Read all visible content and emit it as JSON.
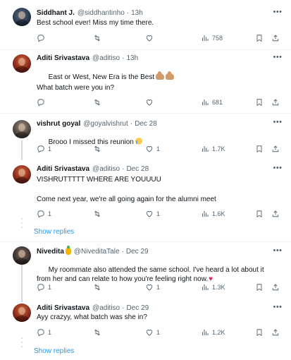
{
  "colors": {
    "text_primary": "#0f1419",
    "text_secondary": "#536471",
    "link": "#1d9bf0",
    "divider": "#eff3f4",
    "thread_line": "#cfd9de"
  },
  "icons": {
    "more": "more-dots-icon",
    "reply": "reply-icon",
    "retweet": "retweet-icon",
    "like": "heart-icon",
    "views": "views-icon",
    "bookmark": "bookmark-icon",
    "share": "share-icon"
  },
  "tweets": [
    {
      "name": "Siddhant J.",
      "handle": "@siddhantinho",
      "separator": "·",
      "time": "13h",
      "text": "Best school ever! Miss my time there.",
      "replies": "",
      "retweets": "",
      "likes": "",
      "views": "758"
    },
    {
      "name": "Aditi Srivastava",
      "handle": "@aditiso",
      "separator": "·",
      "time": "13h",
      "text": "East or West, New Era is the Best",
      "text_line2": "What batch were you in?",
      "replies": "",
      "retweets": "",
      "likes": "",
      "views": "681"
    },
    {
      "name": "vishrut goyal",
      "handle": "@goyalvishrut",
      "separator": "·",
      "time": "Dec 28",
      "text": "Brooo I missed this reunion",
      "replies": "1",
      "retweets": "",
      "likes": "1",
      "views": "1.7K"
    },
    {
      "name": "Aditi Srivastava",
      "handle": "@aditiso",
      "separator": "·",
      "time": "Dec 28",
      "text": "VISHRUTTTTT WHERE ARE YOUUUU",
      "text_line2": "Come next year, we're all going again for the alumni meet",
      "replies": "1",
      "retweets": "",
      "likes": "1",
      "views": "1.6K"
    },
    {
      "name": "Nivedita",
      "handle": "@NiveditaTale",
      "separator": "·",
      "time": "Dec 29",
      "text": "My roommate also attended the same school. I've heard a lot about it from her and can relate to how you're feeling right now.",
      "replies": "1",
      "retweets": "",
      "likes": "1",
      "views": "1.3K"
    },
    {
      "name": "Aditi Srivastava",
      "handle": "@aditiso",
      "separator": "·",
      "time": "Dec 29",
      "text": "Ayy crazyy, what batch was she in?",
      "replies": "1",
      "retweets": "",
      "likes": "1",
      "views": "1.2K"
    }
  ],
  "show_replies": [
    "Show replies",
    "Show replies"
  ]
}
